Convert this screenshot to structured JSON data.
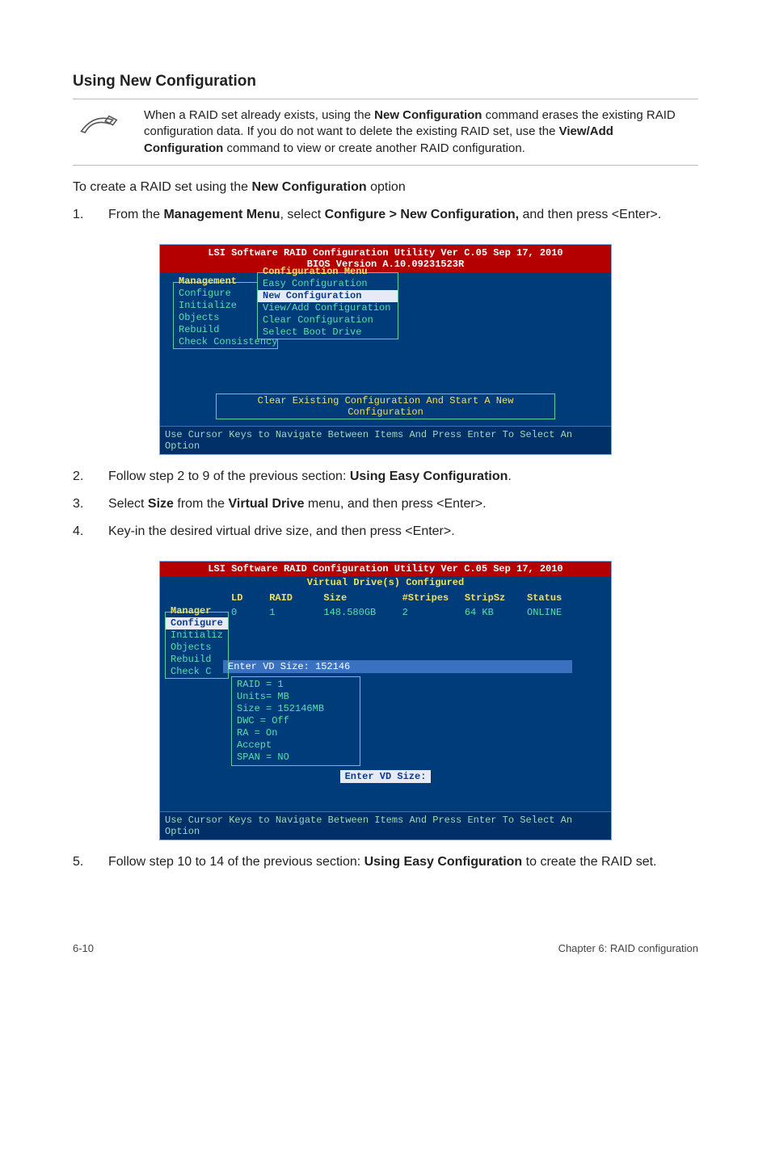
{
  "heading": "Using New Configuration",
  "note": {
    "parts": [
      {
        "t": "When a RAID set already exists, using the "
      },
      {
        "t": "New Configuration",
        "b": true
      },
      {
        "t": " command erases the existing RAID configuration data. If you do not want to delete the existing RAID set, use the "
      },
      {
        "t": "View/Add Configuration",
        "b": true
      },
      {
        "t": " command to view or create another RAID configuration."
      }
    ]
  },
  "lead": [
    {
      "t": "To create a RAID set using the "
    },
    {
      "t": "New Configuration",
      "b": true
    },
    {
      "t": " option"
    }
  ],
  "steps_first": [
    {
      "num": "1.",
      "parts": [
        {
          "t": "From the "
        },
        {
          "t": "Management Menu",
          "b": true
        },
        {
          "t": ", select "
        },
        {
          "t": "Configure > New Configuration,",
          "b": true
        },
        {
          "t": " and then press <Enter>."
        }
      ]
    }
  ],
  "steps_second": [
    {
      "num": "2.",
      "parts": [
        {
          "t": "Follow step 2 to 9 of the previous section: "
        },
        {
          "t": "Using Easy Configuration",
          "b": true
        },
        {
          "t": "."
        }
      ]
    },
    {
      "num": "3.",
      "parts": [
        {
          "t": "Select "
        },
        {
          "t": "Size",
          "b": true
        },
        {
          "t": " from the "
        },
        {
          "t": "Virtual Drive",
          "b": true
        },
        {
          "t": " menu, and then press <Enter>."
        }
      ]
    },
    {
      "num": "4.",
      "parts": [
        {
          "t": "Key-in the desired virtual drive size, and then press <Enter>."
        }
      ]
    }
  ],
  "steps_third": [
    {
      "num": "5.",
      "parts": [
        {
          "t": "Follow step 10 to 14 of the previous section: "
        },
        {
          "t": "Using Easy Configuration",
          "b": true
        },
        {
          "t": " to create the RAID set."
        }
      ]
    }
  ],
  "bios1": {
    "title_line1": "LSI Software RAID Configuration Utility Ver C.05 Sep 17, 2010",
    "title_line2": "BIOS Version   A.10.09231523R",
    "mgmt_label": "Management",
    "mgmt_items": [
      "Configure",
      "Initialize",
      "Objects",
      "Rebuild",
      "Check Consistency"
    ],
    "cfg_label": "Configuration Menu",
    "cfg_items": [
      {
        "label": "Easy Configuration",
        "hl": false
      },
      {
        "label": "New Configuration",
        "hl": true
      },
      {
        "label": "View/Add Configuration",
        "hl": false
      },
      {
        "label": "Clear Configuration",
        "hl": false
      },
      {
        "label": "Select Boot Drive",
        "hl": false
      }
    ],
    "status": "Clear Existing Configuration And Start A New Configuration",
    "footer": "Use Cursor Keys to Navigate Between Items And Press Enter To Select An Option"
  },
  "bios2": {
    "title_line1": "LSI Software RAID Configuration Utility Ver C.05 Sep 17, 2010",
    "title_line2": "Virtual Drive(s) Configured",
    "cols": {
      "c1": "LD",
      "c2": "RAID",
      "c3": "Size",
      "c4": "#Stripes",
      "c5": "StripSz",
      "c6": "Status"
    },
    "row": {
      "c1": "0",
      "c2": "1",
      "c3": "148.580GB",
      "c4": "2",
      "c5": "64 KB",
      "c6": "ONLINE"
    },
    "side_items": [
      "Manager",
      "Configure",
      "Initializ",
      "Objects",
      "Rebuild",
      "Check C"
    ],
    "input_line": "Enter VD Size: 152146",
    "panel": [
      "RAID = 1",
      "Units= MB",
      "Size = 152146MB",
      "DWC  = Off",
      "RA   = On",
      "Accept",
      "SPAN = NO"
    ],
    "prompt": "Enter VD Size:",
    "footer": "Use Cursor Keys to Navigate Between Items And Press Enter To Select An Option"
  },
  "footer": {
    "left": "6-10",
    "right": "Chapter 6: RAID configuration"
  }
}
